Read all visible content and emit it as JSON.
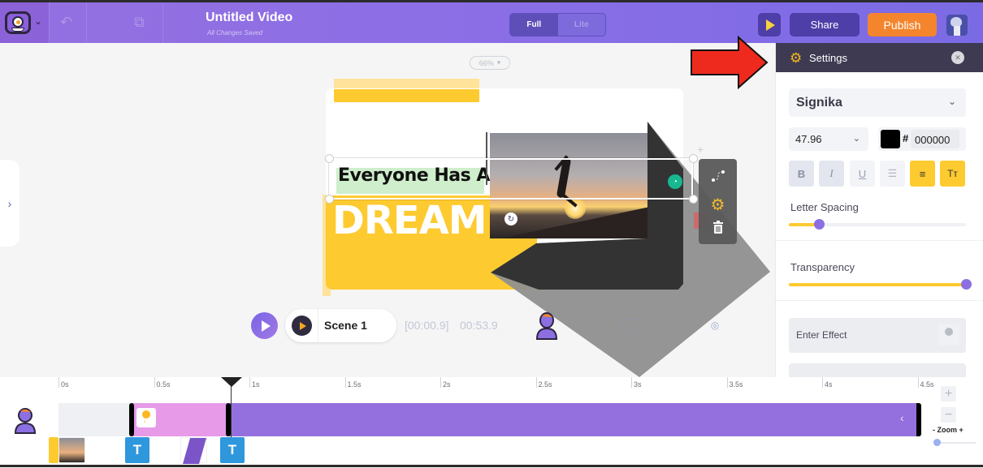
{
  "header": {
    "title": "Untitled Video",
    "subtitle": "All Changes Saved",
    "mode_toggle": {
      "options": [
        "Full",
        "Lite"
      ],
      "selected": "Full"
    },
    "share_label": "Share",
    "publish_label": "Publish",
    "icons": [
      "logo-icon",
      "chevron-down-icon",
      "undo-icon",
      "duplicate-icon",
      "play-icon",
      "user-avatar"
    ]
  },
  "canvas": {
    "zoom_level": "66%",
    "text_line1": "Everyone Has A",
    "text_line2": "DREAM"
  },
  "floating_toolbar": {
    "icons": [
      "motion-path-icon",
      "gear-icon",
      "trash-icon"
    ]
  },
  "player": {
    "scene_label": "Scene 1",
    "current_time": "[00:00.9]",
    "total_time": "00:53.9"
  },
  "settings": {
    "title": "Settings",
    "font_family": "Signika",
    "font_size": "47.96",
    "color_hash": "#",
    "color_hex": "000000",
    "color_swatch": "#000000",
    "format_buttons": [
      {
        "label": "B",
        "name": "bold-button",
        "state": "pressed"
      },
      {
        "label": "I",
        "name": "italic-button",
        "state": "pressed"
      },
      {
        "label": "U",
        "name": "underline-button",
        "state": "off"
      },
      {
        "label": "☰",
        "name": "list-button",
        "state": "off"
      },
      {
        "label": "≡",
        "name": "align-left-button",
        "state": "active"
      },
      {
        "label": "Tт",
        "name": "text-case-button",
        "state": "active"
      }
    ],
    "letter_spacing": {
      "label": "Letter Spacing",
      "value_fraction": 0.17
    },
    "transparency": {
      "label": "Transparency",
      "value_fraction": 1.0
    },
    "enter_effect_label": "Enter Effect"
  },
  "timeline": {
    "ticks": [
      "0s",
      "0.5s",
      "1s",
      "1.5s",
      "2s",
      "2.5s",
      "3s",
      "3.5s",
      "4s",
      "4.5s"
    ],
    "playhead_time_s": 0.9,
    "zoom_label": "- Zoom +",
    "zoom_plus": "+",
    "zoom_minus": "−",
    "element_labels": {
      "text": "T"
    }
  },
  "colors": {
    "header_purple": "#8b6ee6",
    "publish_orange": "#f4852c",
    "accent_yellow": "#fdca30",
    "slider_knob": "#8c6fe0",
    "track_purple": "#9470de",
    "track_pink": "#e69ae8",
    "text_element_blue": "#2f97dc"
  }
}
